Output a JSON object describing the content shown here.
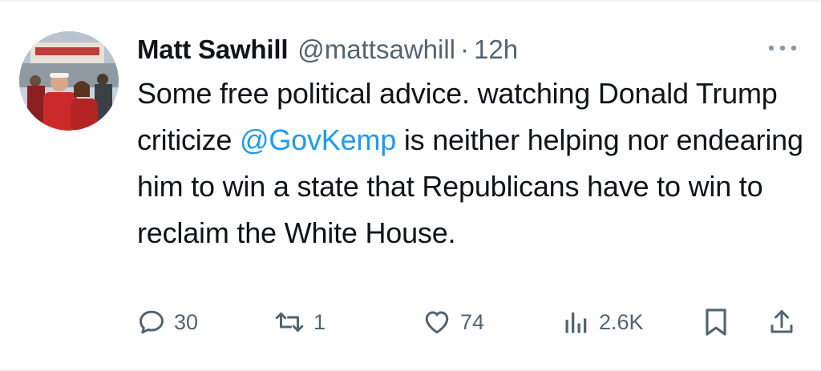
{
  "tweet": {
    "display_name": "Matt Sawhill",
    "handle": "@mattsawhill",
    "separator": "·",
    "time": "12h",
    "text_parts": {
      "before": "Some free political advice. watching Donald Trump criticize ",
      "mention": "@GovKemp",
      "after": " is neither helping nor endearing him to win a state that Republicans have to win to reclaim the White House."
    }
  },
  "actions": {
    "reply_count": "30",
    "retweet_count": "1",
    "like_count": "74",
    "views_count": "2.6K"
  },
  "icons": {
    "more": "more-dots-icon",
    "reply": "reply-icon",
    "retweet": "retweet-icon",
    "like": "heart-icon",
    "views": "views-chart-icon",
    "bookmark": "bookmark-icon",
    "share": "share-icon"
  },
  "colors": {
    "text": "#0f1419",
    "secondary": "#536471",
    "mention": "#1d9bf0",
    "divider": "#eff3f4"
  }
}
